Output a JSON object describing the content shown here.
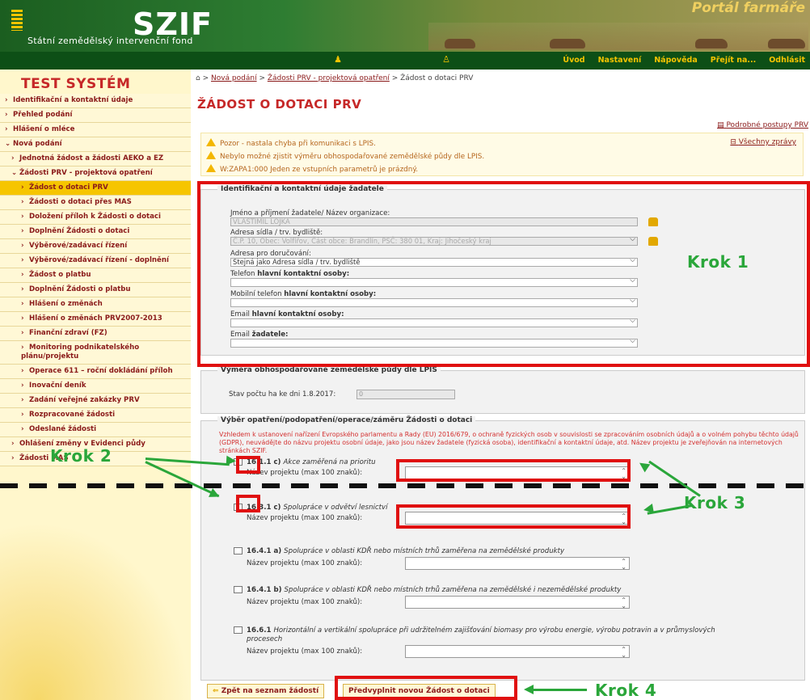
{
  "header": {
    "logo": "SZIF",
    "subtitle": "Státní zemědělský intervenční fond",
    "portal": "Portál farmáře"
  },
  "nav": {
    "links": [
      "Úvod",
      "Nastavení",
      "Nápověda",
      "Přejít na...",
      "Odhlásit"
    ]
  },
  "sidebar": {
    "title": "TEST SYSTÉM",
    "items": [
      {
        "label": "Identifikační a kontaktní údaje",
        "level": 0,
        "chev": ">"
      },
      {
        "label": "Přehled podání",
        "level": 0,
        "chev": ">"
      },
      {
        "label": "Hlášení o mléce",
        "level": 0,
        "chev": ">"
      },
      {
        "label": "Nová podání",
        "level": 0,
        "chev": "v"
      },
      {
        "label": "Jednotná žádost a žádosti AEKO a EZ",
        "level": 1,
        "chev": ">"
      },
      {
        "label": "Žádosti PRV - projektová opatření",
        "level": 1,
        "chev": "v"
      },
      {
        "label": "Žádost o dotaci PRV",
        "level": 2,
        "chev": ">",
        "active": true
      },
      {
        "label": "Žádosti o dotaci přes MAS",
        "level": 2,
        "chev": ">"
      },
      {
        "label": "Doložení příloh k Žádosti o dotaci",
        "level": 2,
        "chev": ">"
      },
      {
        "label": "Doplnění Žádosti o dotaci",
        "level": 2,
        "chev": ">"
      },
      {
        "label": "Výběrové/zadávací řízení",
        "level": 2,
        "chev": ">"
      },
      {
        "label": "Výběrové/zadávací řízení - doplnění",
        "level": 2,
        "chev": ">"
      },
      {
        "label": "Žádost o platbu",
        "level": 2,
        "chev": ">"
      },
      {
        "label": "Doplnění Žádosti o platbu",
        "level": 2,
        "chev": ">"
      },
      {
        "label": "Hlášení o změnách",
        "level": 2,
        "chev": ">"
      },
      {
        "label": "Hlášení o změnách PRV2007-2013",
        "level": 2,
        "chev": ">"
      },
      {
        "label": "Finanční zdraví (FZ)",
        "level": 2,
        "chev": ">"
      },
      {
        "label": "Monitoring podnikatelského plánu/projektu",
        "level": 2,
        "chev": ">"
      },
      {
        "label": "Operace 611 – roční dokládání příloh",
        "level": 2,
        "chev": ">"
      },
      {
        "label": "Inovační deník",
        "level": 2,
        "chev": ">"
      },
      {
        "label": "Zadání veřejné zakázky PRV",
        "level": 2,
        "chev": ">"
      },
      {
        "label": "Rozpracované žádosti",
        "level": 2,
        "chev": ">"
      },
      {
        "label": "Odeslané žádosti",
        "level": 2,
        "chev": ">"
      },
      {
        "label": "Ohlášení změny v Evidenci půdy",
        "level": 1,
        "chev": ">"
      },
      {
        "label": "Žádosti MAS",
        "level": 1,
        "chev": ">"
      }
    ]
  },
  "breadcrumb": {
    "new": "Nová podání",
    "prv": "Žádosti PRV - projektová opatření",
    "current": "Žádost o dotaci PRV"
  },
  "page": {
    "title": "ŽÁDOST O DOTACI PRV",
    "procedures": "Podrobné postupy PRV",
    "all_messages": "Všechny zprávy"
  },
  "messages": [
    "Pozor - nastala chyba při komunikaci s LPIS.",
    "Nebylo možné zjistit výměru obhospodařované zemědělské půdy dle LPIS.",
    "W:ZAPA1:000 Jeden ze vstupních parametrů je prázdný."
  ],
  "identification": {
    "title": "Identifikační a kontaktní údaje žadatele",
    "name_label": "Jméno a příjmení žadatele/ Název organizace:",
    "name_value": "VLASTIMIL LOJKA",
    "address_label": "Adresa sídla / trv. bydliště:",
    "address_value": "Č.P. 10, Obec: Volfířov, Část obce: Brandlín, PSČ: 380 01, Kraj: Jihočeský kraj",
    "delivery_label": "Adresa pro doručování:",
    "delivery_value": "Stejná jako Adresa sídla / trv. bydliště",
    "phone_label_a": "Telefon ",
    "phone_label_b": "hlavní kontaktní osoby:",
    "mobile_label_a": "Mobilní telefon ",
    "mobile_label_b": "hlavní kontaktní osoby:",
    "email_label_a": "Email ",
    "email_label_b": "hlavní kontaktní osoby:",
    "email2_label_a": "Email ",
    "email2_label_b": "žadatele:"
  },
  "lpis": {
    "title": "Výměra obhospodařované zemědělské půdy dle LPIS",
    "stav_label": "Stav počtu ha ke dni 1.8.2017:",
    "stav_value": "0"
  },
  "selection": {
    "title": "Výběr opatření/podopatření/operace/záměru Žádosti o dotaci",
    "legal": "Vzhledem k ustanovení nařízení Evropského parlamentu a Rady (EU) 2016/679, o ochraně fyzických osob v souvislosti se zpracováním osobních údajů a o volném pohybu těchto údajů (GDPR), neuvádějte do názvu projektu osobní údaje, jako jsou název žadatele (fyzická osoba), identifikační a kontaktní údaje, atd. Název projektu je zveřejňován na internetových stránkách SZIF.",
    "name_label": "Název projektu (max 100 znaků):",
    "measures": [
      {
        "code": "16.1.1 c)",
        "desc": "Akce zaměřená na prioritu"
      },
      {
        "code": "16.3.1 c)",
        "desc": "Spolupráce v odvětví lesnictví"
      },
      {
        "code": "16.4.1 a)",
        "desc": "Spolupráce v oblasti KDŘ nebo místních trhů zaměřena na zemědělské produkty"
      },
      {
        "code": "16.4.1 b)",
        "desc": "Spolupráce v oblasti KDŘ nebo místních trhů zaměřena na zemědělské i nezemědělské produkty"
      },
      {
        "code": "16.6.1",
        "desc": "Horizontální a vertikální spolupráce při udržitelném zajišťování biomasy pro výrobu energie, výrobu potravin a v průmyslových procesech"
      }
    ]
  },
  "buttons": {
    "back": "Zpět na seznam žádostí",
    "prefill": "Předvyplnit novou Žádost o dotaci"
  },
  "annotations": {
    "krok1": "Krok 1",
    "krok2": "Krok 2",
    "krok3": "Krok 3",
    "krok4": "Krok 4"
  },
  "colors": {
    "brand_green": "#0d4f16",
    "accent_yellow": "#f5c400",
    "title_red": "#c62828",
    "annotation_red": "#e01010",
    "annotation_green": "#2aa63a"
  }
}
